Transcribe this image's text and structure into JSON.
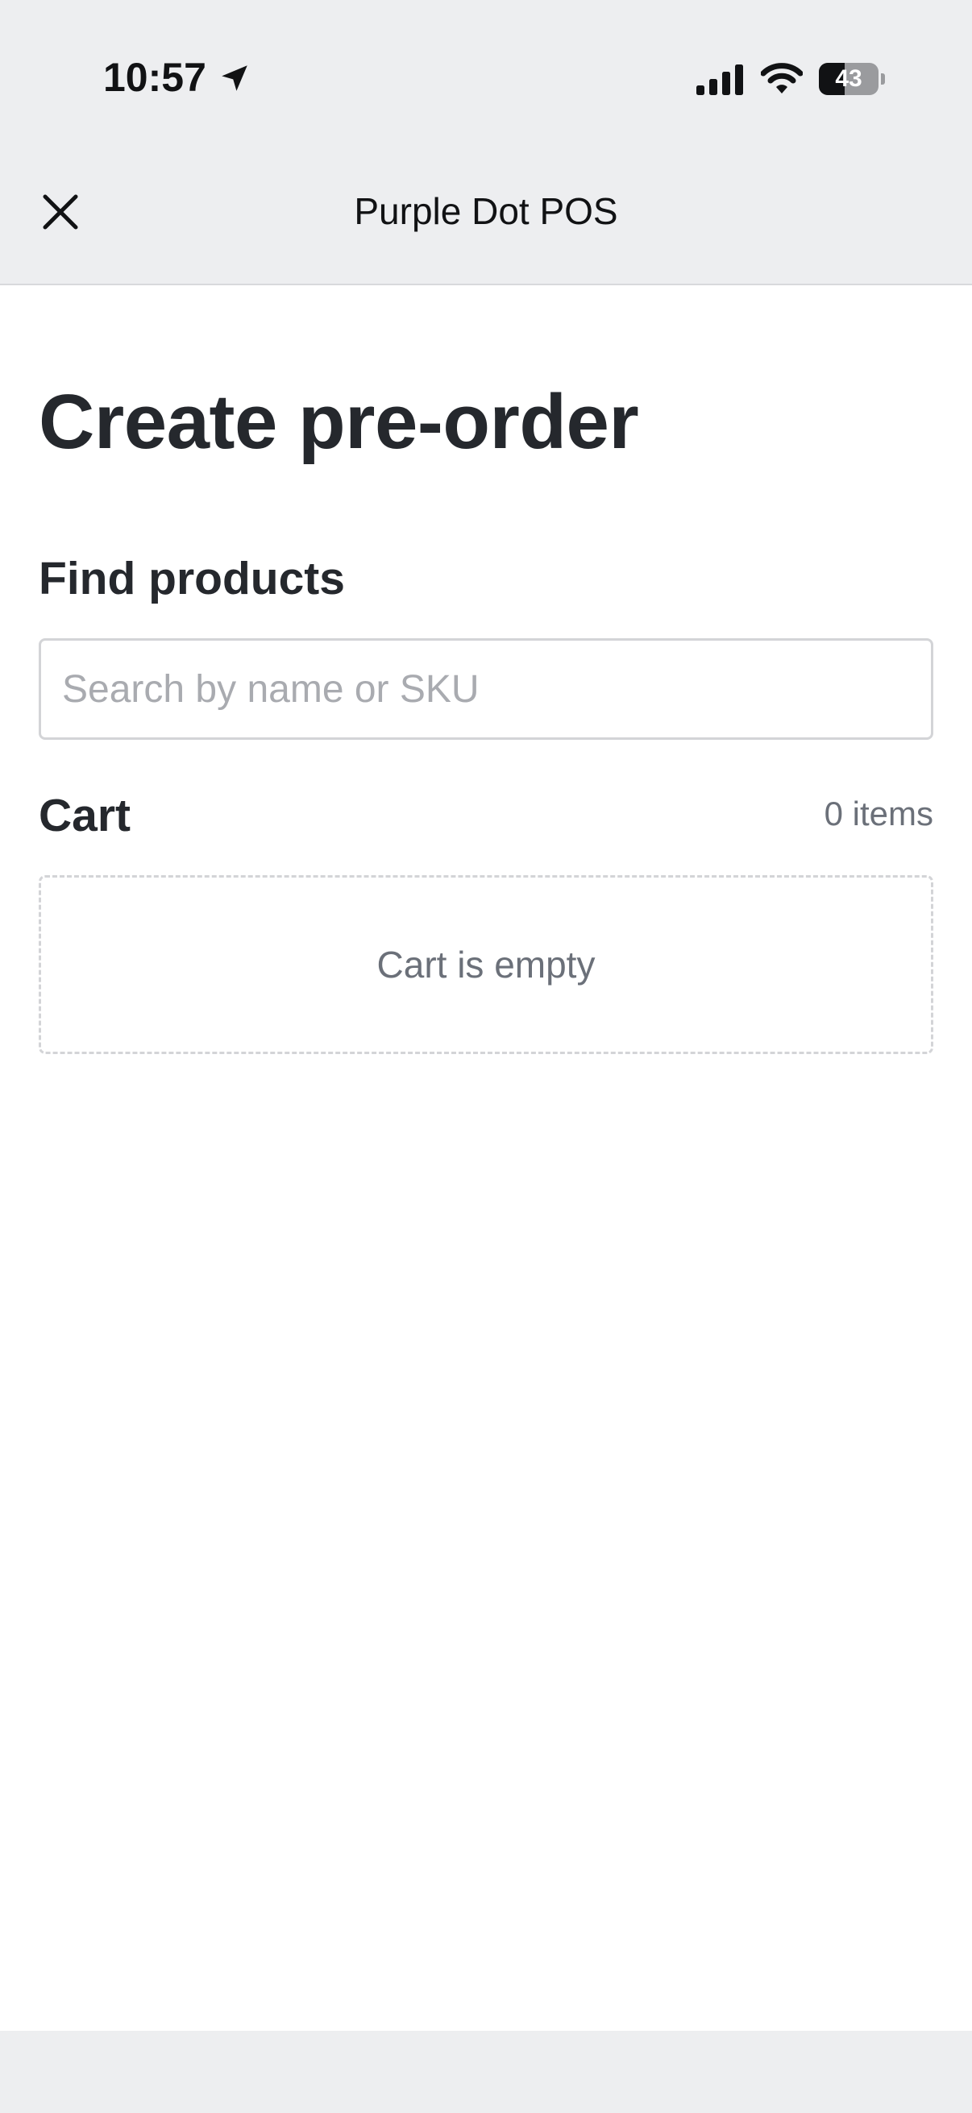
{
  "status_bar": {
    "time": "10:57",
    "location_icon": "location-arrow-icon",
    "signal_icon": "cellular-signal-icon",
    "wifi_icon": "wifi-icon",
    "battery_level": "43",
    "battery_fraction": 0.43
  },
  "nav": {
    "close_icon": "close-icon",
    "title": "Purple Dot POS"
  },
  "page": {
    "title": "Create pre-order"
  },
  "find_products": {
    "label": "Find products",
    "search_value": "",
    "search_placeholder": "Search by name or SKU"
  },
  "cart": {
    "label": "Cart",
    "count_text": "0 items",
    "empty_text": "Cart is empty"
  },
  "colors": {
    "chrome_background": "#edeef0",
    "text_primary": "#25282d",
    "text_secondary": "#6b7079",
    "border": "#d3d4d7"
  }
}
